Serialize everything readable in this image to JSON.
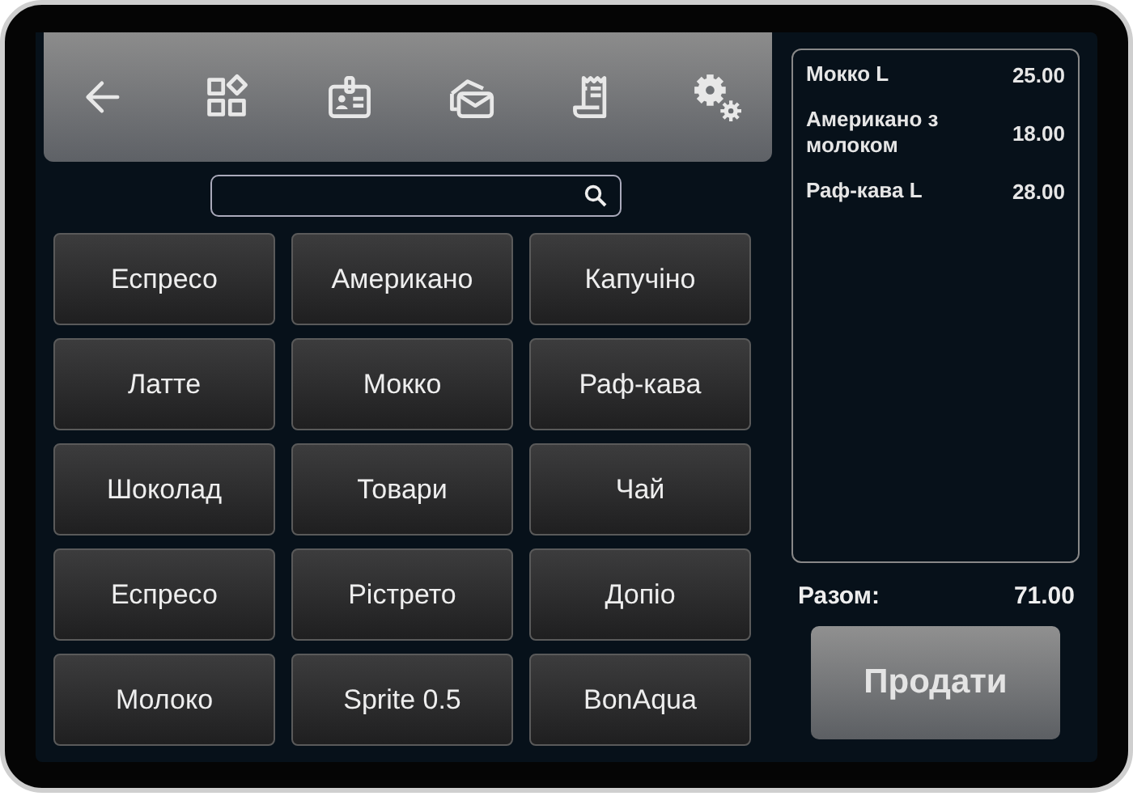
{
  "toolbar": {
    "buttons": [
      {
        "kind": "back"
      },
      {
        "kind": "grid"
      },
      {
        "kind": "badge"
      },
      {
        "kind": "mail"
      },
      {
        "kind": "receipt"
      },
      {
        "kind": "settings"
      }
    ]
  },
  "products": [
    {
      "label": "Еспресо"
    },
    {
      "label": "Американо"
    },
    {
      "label": "Капучіно"
    },
    {
      "label": "Латте"
    },
    {
      "label": "Мокко"
    },
    {
      "label": "Раф-кава"
    },
    {
      "label": "Шоколад"
    },
    {
      "label": "Товари"
    },
    {
      "label": "Чай"
    },
    {
      "label": "Еспресо"
    },
    {
      "label": "Рістрето"
    },
    {
      "label": "Допіо"
    },
    {
      "label": "Молоко"
    },
    {
      "label": "Sprite 0.5"
    },
    {
      "label": "BonAqua"
    }
  ],
  "order": {
    "items": [
      {
        "name": "Мокко L",
        "price": "25.00"
      },
      {
        "name": "Американо з молоком",
        "price": "18.00"
      },
      {
        "name": "Раф-кава L",
        "price": "28.00"
      }
    ],
    "total_label": "Разом:",
    "total": "71.00"
  },
  "sell_button": "Продати"
}
